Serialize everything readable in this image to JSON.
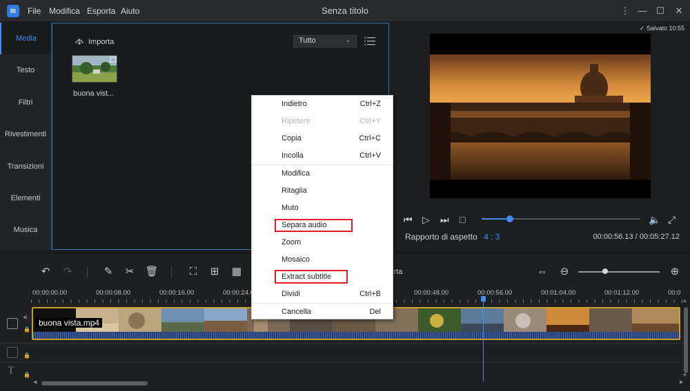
{
  "app": {
    "title": "Senza titolo",
    "logo_text": "Ilt",
    "menu": [
      "File",
      "Modifica",
      "Esporta",
      "Aiuto"
    ]
  },
  "window_controls": {
    "more_glyph": "⋮",
    "minimize_glyph": "—",
    "maximize_glyph": "☐",
    "close_glyph": "✕"
  },
  "sidebar": {
    "tabs": [
      {
        "label": "Media",
        "active": true
      },
      {
        "label": "Testo",
        "active": false
      },
      {
        "label": "Filtri",
        "active": false
      },
      {
        "label": "Rivestimenti",
        "active": false
      },
      {
        "label": "Transizioni",
        "active": false
      },
      {
        "label": "Elementi",
        "active": false
      },
      {
        "label": "Musica",
        "active": false
      }
    ]
  },
  "media": {
    "import_label": "Importa",
    "filter_value": "Tutto",
    "items": [
      {
        "label": "buona vist..."
      }
    ]
  },
  "preview": {
    "saved_text": "Salvato 10:55",
    "aspect_label": "Rapporto di aspetto",
    "aspect_value": "4 : 3",
    "current_time": "00:00:56.13",
    "total_time": "00:05:27.12",
    "time_separator": "/",
    "progress_fraction": 0.18
  },
  "timeline": {
    "ruler_labels": [
      "00:00:00.00",
      "00:00:08.00",
      "00:00:16.00",
      "00:00:24.0",
      "00:00:48.00",
      "00:00:56.00",
      "00:01:04.00",
      "00:01:12.00",
      "00:0"
    ],
    "partial_text": "rta",
    "clip_label": "buona vista.mp4",
    "zoom_fraction": 0.3,
    "up_arrow": "▲",
    "down_arrow": "▼",
    "left_arrow": "◀",
    "right_arrow": "▶"
  },
  "context_menu": {
    "items": [
      {
        "label": "Indietro",
        "shortcut": "Ctrl+Z",
        "disabled": false
      },
      {
        "label": "Ripetere",
        "shortcut": "Ctrl+Y",
        "disabled": true
      },
      {
        "label": "Copia",
        "shortcut": "Ctrl+C",
        "disabled": false
      },
      {
        "label": "Incolla",
        "shortcut": "Ctrl+V",
        "disabled": false
      },
      {
        "label": "Modifica",
        "shortcut": "",
        "disabled": false
      },
      {
        "label": "Ritaglia",
        "shortcut": "",
        "disabled": false
      },
      {
        "label": "Muto",
        "shortcut": "",
        "disabled": false
      },
      {
        "label": "Separa audio",
        "shortcut": "",
        "disabled": false,
        "highlighted": true
      },
      {
        "label": "Zoom",
        "shortcut": "",
        "disabled": false
      },
      {
        "label": "Mosaico",
        "shortcut": "",
        "disabled": false
      },
      {
        "label": "Extract subtitle",
        "shortcut": "",
        "disabled": false,
        "highlighted": true
      },
      {
        "label": "Dividi",
        "shortcut": "Ctrl+B",
        "disabled": false
      },
      {
        "label": "Cancella",
        "shortcut": "Del",
        "disabled": false
      }
    ]
  },
  "colors": {
    "accent": "#3d8df5",
    "highlight_box": "#e01b24",
    "clip_border": "#c9a12a"
  }
}
